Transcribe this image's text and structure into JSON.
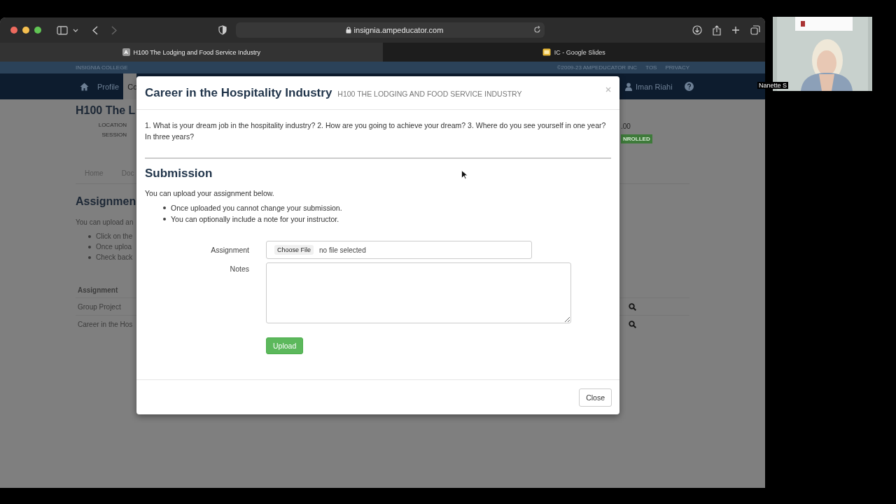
{
  "browser": {
    "url": "insignia.ampeducator.com",
    "tabs": [
      {
        "label": "H100 The Lodging and Food Service Industry",
        "favicon_letter": "A",
        "selected": true
      },
      {
        "label": "IC - Google Slides",
        "selected": false
      }
    ]
  },
  "site": {
    "brand": "INSIGNIA COLLEGE",
    "footer_links": [
      "©2009-23 AMPEDUCATOR INC",
      "TOS",
      "PRIVACY"
    ],
    "nav": [
      {
        "label": "Profile",
        "selected": false
      },
      {
        "label": "Co",
        "selected": true
      }
    ],
    "user": "Iman Riahi"
  },
  "course": {
    "title": "H100 The L",
    "meta_labels": [
      "LOCATION",
      "SESSION"
    ],
    "fee": ".00",
    "status": "NROLLED",
    "tabs": [
      "Home",
      "Doc"
    ],
    "heading": "Assignmen",
    "intro": "You can upload an",
    "steps": [
      "Click on the",
      "Once uploa",
      "Check back"
    ],
    "table": {
      "columns": [
        "Assignment"
      ],
      "rows": [
        "Group Project",
        "Career in the Hos"
      ]
    }
  },
  "modal": {
    "title": "Career in the Hospitality Industry",
    "subtitle": "H100 THE LODGING AND FOOD SERVICE INDUSTRY",
    "prompt": "1. What is your dream job in the hospitality industry? 2. How are you going to achieve your dream? 3. Where do you see yourself in one year? In three years?",
    "section": "Submission",
    "intro": "You can upload your assignment below.",
    "bullets": [
      "Once uploaded you cannot change your submission.",
      "You can optionally include a note for your instructor."
    ],
    "form": {
      "assignment_label": "Assignment",
      "choose_button": "Choose File",
      "file_status": "no file selected",
      "notes_label": "Notes",
      "upload_button": "Upload"
    },
    "close_button": "Close"
  },
  "video": {
    "name": "Nanette S"
  }
}
